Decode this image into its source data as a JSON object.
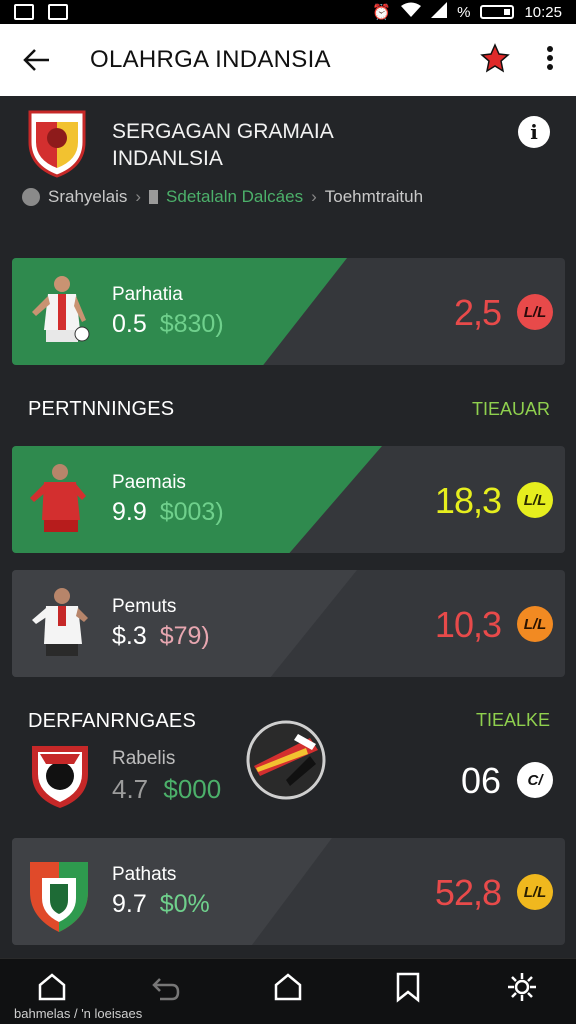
{
  "status_bar": {
    "battery": "%",
    "time": "10:25"
  },
  "app_bar": {
    "title": "OLAHRGA INDANSIA"
  },
  "team": {
    "name_line1": "SERGAGAN GRAMAIA",
    "name_line2": "INDANLSIA",
    "breadcrumb": [
      "Srahyelais",
      "Sdetalaln Dalcáes",
      "Toehmtraituh"
    ]
  },
  "featured_player": {
    "name": "Parhatia",
    "stat": "0.5",
    "price": "$830)",
    "score": "2,5",
    "badge": "L/L",
    "score_color": "#e84a4a",
    "badge_color": "#e84a4a"
  },
  "section_1": {
    "title": "PERTNNINGES",
    "link": "TIEAUAR"
  },
  "players": [
    {
      "name": "Paemais",
      "stat": "9.9",
      "price": "$003)",
      "score": "18,3",
      "badge": "L/L",
      "score_color": "#e6ee1e",
      "badge_color": "#e6ee1e"
    },
    {
      "name": "Pemuts",
      "stat": "$.3",
      "price": "$79)",
      "score": "10,3",
      "badge": "L/L",
      "score_color": "#e84a4a",
      "badge_color": "#f28a22"
    }
  ],
  "section_2": {
    "title": "DERFANRNGAES",
    "link": "TIEALKE"
  },
  "defender": {
    "name": "Rabelis",
    "stat": "4.7",
    "price": "$000",
    "score": "06",
    "badge": "C/"
  },
  "last_player": {
    "name": "Pathats",
    "stat": "9.7",
    "price": "$0%",
    "score": "52,8",
    "badge": "L/L",
    "score_color": "#e84a4a",
    "badge_color": "#f0b81e"
  },
  "bottom_nav": {
    "caption": "bahmelas / 'n loeisaes"
  }
}
